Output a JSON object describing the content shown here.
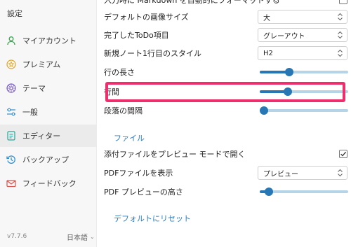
{
  "sidebar": {
    "title": "設定",
    "items": [
      {
        "label": "マイアカウント",
        "icon": "user-icon",
        "active": false
      },
      {
        "label": "プレミアム",
        "icon": "star-icon",
        "active": false
      },
      {
        "label": "テーマ",
        "icon": "palette-icon",
        "active": false
      },
      {
        "label": "一般",
        "icon": "sliders-icon",
        "active": false
      },
      {
        "label": "エディター",
        "icon": "editor-icon",
        "active": true
      },
      {
        "label": "バックアップ",
        "icon": "backup-icon",
        "active": false
      },
      {
        "label": "フィードバック",
        "icon": "mail-icon",
        "active": false
      }
    ],
    "version": "v7.7.6",
    "language": "日本語"
  },
  "editor": {
    "top_partial_label": "入力時に Markdown を自動的にフォーマットする",
    "default_image_size_label": "デフォルトの画像サイズ",
    "default_image_size_value": "大",
    "completed_todo_label": "完了したToDo項目",
    "completed_todo_value": "グレーアウト",
    "first_line_style_label": "新規ノート1行目のスタイル",
    "first_line_style_value": "H2",
    "line_length_label": "行の長さ",
    "line_length_level": 0.33,
    "line_spacing_label": "行間",
    "line_spacing_level": 0.32,
    "paragraph_spacing_label": "段落の間隔",
    "paragraph_spacing_level": 0.0
  },
  "file": {
    "section_title": "ファイル",
    "open_attachments_label": "添付ファイルをプレビュー モードで開く",
    "open_attachments_checked": true,
    "show_pdf_label": "PDFファイルを表示",
    "show_pdf_value": "プレビュー",
    "pdf_preview_height_label": "PDF プレビューの高さ",
    "pdf_preview_height_level": 0.1
  },
  "reset_label": "デフォルトにリセット",
  "colors": {
    "accent": "#2777b5",
    "track": "#b5d4e8",
    "highlight": "#ee2f6e",
    "link": "#2b7dc0"
  }
}
